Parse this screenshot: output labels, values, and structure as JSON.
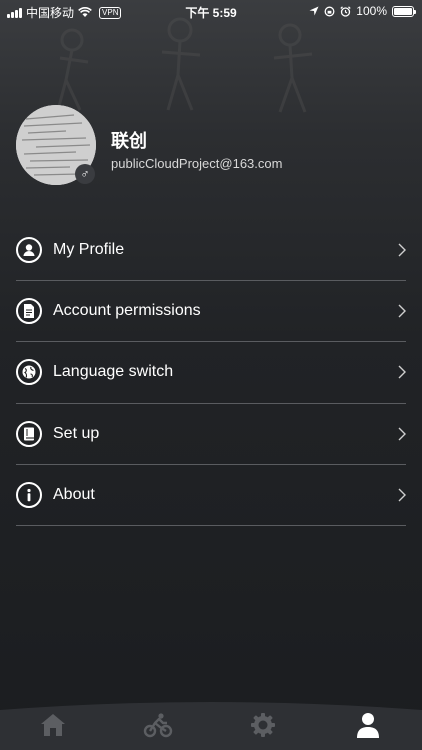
{
  "status_bar": {
    "carrier": "中国移动",
    "vpn": "VPN",
    "time": "下午 5:59",
    "battery": "100%",
    "battery_level": 1.0
  },
  "profile": {
    "name": "联创",
    "email": "publicCloudProject@163.com",
    "gender_symbol": "♂"
  },
  "menu": {
    "items": [
      {
        "label": "My Profile",
        "icon": "user-icon"
      },
      {
        "label": "Account permissions",
        "icon": "document-icon"
      },
      {
        "label": "Language switch",
        "icon": "globe-icon"
      },
      {
        "label": "Set up",
        "icon": "book-icon"
      },
      {
        "label": "About",
        "icon": "info-icon"
      }
    ]
  },
  "tab_bar": {
    "tabs": [
      {
        "name": "home",
        "icon": "home-icon",
        "active": false
      },
      {
        "name": "cycling",
        "icon": "bicycle-icon",
        "active": false
      },
      {
        "name": "settings",
        "icon": "gear-icon",
        "active": false
      },
      {
        "name": "profile",
        "icon": "person-icon",
        "active": true
      }
    ]
  },
  "colors": {
    "background": "#1e2023",
    "divider": "#5a5c60",
    "tab_inactive": "#5c5e62",
    "tab_active": "#ffffff"
  }
}
